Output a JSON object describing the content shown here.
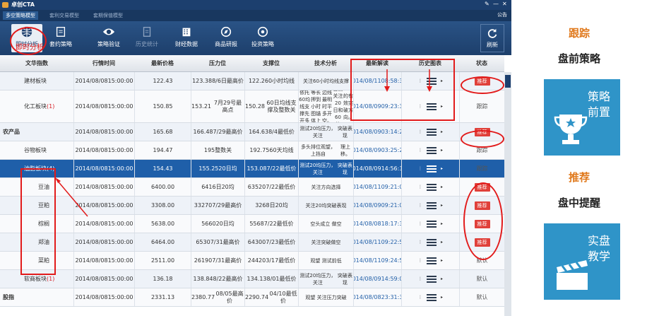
{
  "app": {
    "title": "卓创CTA"
  },
  "tabs": [
    "多空策略模型",
    "套利交易模型",
    "套期保值模型"
  ],
  "notice": "公告",
  "toolbar": {
    "buttons": [
      {
        "label": "即时分析",
        "icon": "globe-icon"
      },
      {
        "label": "套约策略",
        "icon": "contract-icon"
      },
      {
        "label": "策略验证",
        "icon": "eye-icon"
      },
      {
        "label": "历史统计",
        "icon": "doc-icon"
      },
      {
        "label": "财经数据",
        "icon": "building-icon"
      },
      {
        "label": "商品研报",
        "icon": "compass-icon"
      },
      {
        "label": "投资策略",
        "icon": "target-icon"
      }
    ],
    "refresh": "刷新"
  },
  "columns": [
    "文华指数",
    "行情时间",
    "最新价格",
    "压力位",
    "支撑位",
    "技术分析",
    "最新解读",
    "历史图表",
    "状态"
  ],
  "rows": [
    {
      "name": "建材板块",
      "cnt": "",
      "time": [
        "2014/08/08",
        "15:00:00"
      ],
      "price": "122.43",
      "press": [
        "123.38",
        "8/6日最高价"
      ],
      "support": [
        "122.2",
        "60小时均线"
      ],
      "tech": [
        "关注60小时均线支撑"
      ],
      "jd": [
        "2014/08/11",
        "08:58:36"
      ],
      "status": "推荐",
      "badge": true,
      "indent": 1
    },
    {
      "name": "化工板块",
      "cnt": "(1)",
      "time": [
        "2014/08/08",
        "15:00:00"
      ],
      "price": "150.85",
      "press": [
        "153.21",
        "7月29号最高点"
      ],
      "support": [
        "150.28",
        "60日均线支撑及整数关"
      ],
      "tech": [
        "依托60均线支撑先开多",
        "等长押到小时图锚体上",
        "边线最明时平多开空。",
        "目前关注20日和60均",
        "的有效突破方向。"
      ],
      "jd": [
        "2014/08/09",
        "09:23:39"
      ],
      "status": "跟踪",
      "badge": false,
      "indent": 1
    },
    {
      "name": "农产品",
      "cnt": "",
      "time": [
        "2014/08/08",
        "15:00:00"
      ],
      "price": "165.68",
      "press": [
        "166.48",
        "7/29最高价"
      ],
      "support": [
        "164.63",
        "8/4最低价"
      ],
      "tech": [
        "测试20均压力，关注",
        "突破表现"
      ],
      "jd": [
        "2014/08/09",
        "03:14:23"
      ],
      "status": "推荐",
      "badge": true,
      "indent": 0
    },
    {
      "name": "谷物板块",
      "cnt": "",
      "time": [
        "2014/08/08",
        "15:00:00"
      ],
      "price": "194.47",
      "press": [
        "195",
        "整数关"
      ],
      "support": [
        "192.75",
        "60天均线"
      ],
      "tech": [
        "多头排位观望，上挡自",
        "理上移。"
      ],
      "jd": [
        "2014/08/09",
        "03:25:22"
      ],
      "status": "跟踪",
      "badge": false,
      "indent": 1
    },
    {
      "name": "油脂板块",
      "cnt": "(4)",
      "time": [
        "2014/08/08",
        "15:00:00"
      ],
      "price": "154.43",
      "press": [
        "155.25",
        "20日均"
      ],
      "support": [
        "153.08",
        "7/22最低价"
      ],
      "tech": [
        "测试20均压力，关注",
        "突破表现"
      ],
      "jd": [
        "2014/08/09",
        "14:56:35"
      ],
      "status": "跟踪",
      "badge": false,
      "indent": 1,
      "selected": true
    },
    {
      "name": "豆油",
      "cnt": "",
      "time": [
        "2014/08/08",
        "15:00:00"
      ],
      "price": "6400.00",
      "press": [
        "6416",
        "日20均"
      ],
      "support": [
        "6352",
        "07/22最低价"
      ],
      "tech": [
        "关注方向选择"
      ],
      "jd": [
        "2014/08/11",
        "09:21:05"
      ],
      "status": "推荐",
      "badge": true,
      "indent": 2
    },
    {
      "name": "豆粕",
      "cnt": "",
      "time": [
        "2014/08/08",
        "15:00:00"
      ],
      "price": "3308.00",
      "press": [
        "3327",
        "07/29最高价"
      ],
      "support": [
        "3268",
        "日20均"
      ],
      "tech": [
        "关注20均突破表现"
      ],
      "jd": [
        "2014/08/09",
        "09:21:05"
      ],
      "status": "推荐",
      "badge": true,
      "indent": 2
    },
    {
      "name": "棕榈",
      "cnt": "",
      "time": [
        "2014/08/08",
        "15:00:00"
      ],
      "price": "5638.00",
      "press": [
        "5660",
        "20日均"
      ],
      "support": [
        "5568",
        "7/22最低价"
      ],
      "tech": [
        "空头成立 做空"
      ],
      "jd": [
        "2014/08/08",
        "18:17:37"
      ],
      "status": "推荐",
      "badge": true,
      "indent": 2
    },
    {
      "name": "郑油",
      "cnt": "",
      "time": [
        "2014/08/08",
        "15:00:00"
      ],
      "price": "6464.00",
      "press": [
        "6530",
        "7/31最高价"
      ],
      "support": [
        "6430",
        "07/23最低价"
      ],
      "tech": [
        "关注突破做空"
      ],
      "jd": [
        "2014/08/11",
        "09:22:52"
      ],
      "status": "推荐",
      "badge": true,
      "indent": 2
    },
    {
      "name": "菜粕",
      "cnt": "",
      "time": [
        "2014/08/08",
        "15:00:00"
      ],
      "price": "2511.00",
      "press": [
        "2619",
        "07/31最高价"
      ],
      "support": [
        "2442",
        "03/17最低价"
      ],
      "tech": [
        "观望 测试前低"
      ],
      "jd": [
        "2014/08/11",
        "09:24:50"
      ],
      "status": "默认",
      "badge": false,
      "indent": 2
    },
    {
      "name": "软商板块",
      "cnt": "(1)",
      "time": [
        "2014/08/08",
        "15:00:00"
      ],
      "price": "136.18",
      "press": [
        "138.84",
        "8/22最高价"
      ],
      "support": [
        "134.13",
        "8/01最低价"
      ],
      "tech": [
        "测试20均压力，关注",
        "突破表现"
      ],
      "jd": [
        "2014/08/09",
        "14:59:04"
      ],
      "status": "默认",
      "badge": false,
      "indent": 1
    },
    {
      "name": "股指",
      "cnt": "",
      "time": [
        "2014/08/08",
        "15:00:00"
      ],
      "price": "2331.13",
      "press": [
        "2380.77",
        "08/05最高价"
      ],
      "support": [
        "2290.74",
        "04/10最低价"
      ],
      "tech": [
        "观望 关注压力突破"
      ],
      "jd": [
        "2014/08/08",
        "23:31:30"
      ],
      "status": "默认",
      "badge": false,
      "indent": 0
    }
  ],
  "annotation": {
    "label": "即时分析"
  },
  "right": {
    "s1_title": "跟踪",
    "s1_sub": "盘前策略",
    "tile1": [
      "策略",
      "前置"
    ],
    "s2_title": "推荐",
    "s2_sub": "盘中提醒",
    "tile2": [
      "实盘",
      "教学"
    ]
  }
}
